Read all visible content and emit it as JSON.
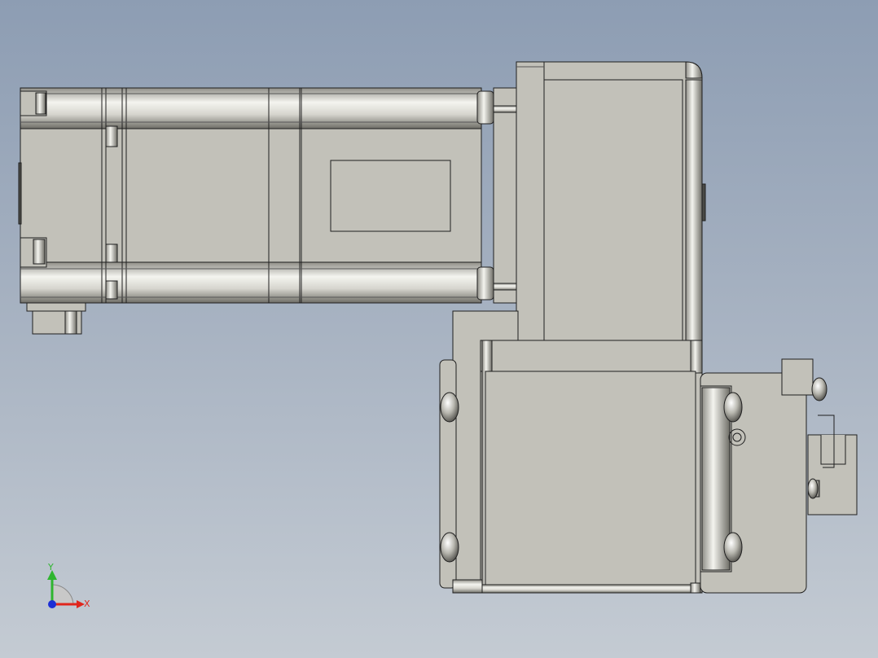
{
  "viewport": {
    "background_top": "#8d9db3",
    "background_bottom": "#c4cbd3"
  },
  "model": {
    "fill_color": "#c2c1b9",
    "edge_color": "#1f1f1f",
    "highlight_color": "#f4f4ef",
    "shadow_color": "#6e6d66"
  },
  "triad": {
    "x_label": "X",
    "y_label": "Y",
    "x_color": "#e0261c",
    "y_color": "#2fb52f",
    "z_color": "#1c2fd6",
    "icon": "coordinate-triad-icon"
  }
}
